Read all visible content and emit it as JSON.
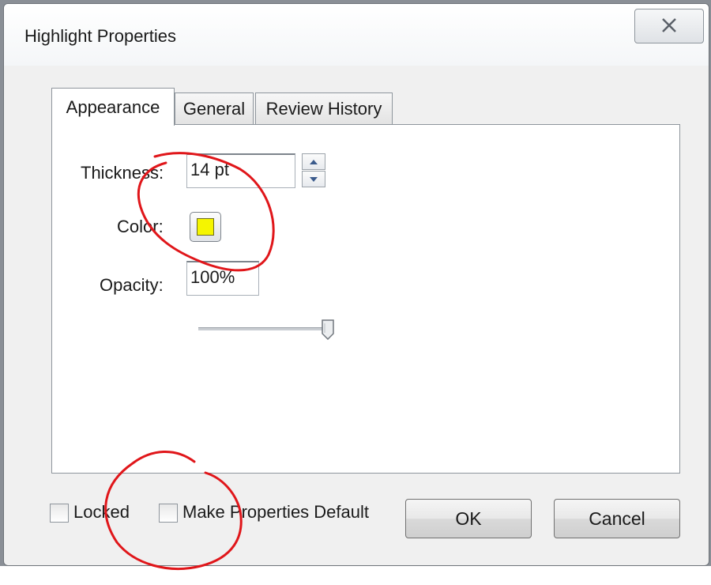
{
  "window": {
    "title": "Highlight Properties",
    "close_icon": "close-icon"
  },
  "tabs": [
    {
      "label": "Appearance",
      "active": true
    },
    {
      "label": "General",
      "active": false
    },
    {
      "label": "Review History",
      "active": false
    }
  ],
  "appearance": {
    "thickness_label": "Thickness:",
    "thickness_value": "14 pt",
    "color_label": "Color:",
    "color_value": "#f5f500",
    "opacity_label": "Opacity:",
    "opacity_value": "100%",
    "opacity_slider_fraction": 1.0
  },
  "footer": {
    "locked_label": "Locked",
    "locked_checked": false,
    "default_label": "Make Properties Default",
    "default_checked": false,
    "ok_label": "OK",
    "cancel_label": "Cancel"
  },
  "colors": {
    "annotation_ink": "#e0161a",
    "window_bg": "#f0f0f0",
    "panel_bg": "#ffffff"
  }
}
